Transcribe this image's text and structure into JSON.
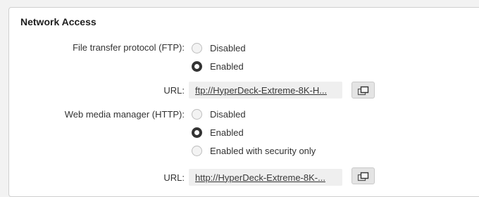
{
  "section": {
    "title": "Network Access"
  },
  "ftp": {
    "label": "File transfer protocol (FTP):",
    "options": [
      {
        "label": "Disabled",
        "selected": false
      },
      {
        "label": "Enabled",
        "selected": true
      }
    ],
    "url_label": "URL:",
    "url_value": "ftp://HyperDeck-Extreme-8K-H..."
  },
  "http": {
    "label": "Web media manager (HTTP):",
    "options": [
      {
        "label": "Disabled",
        "selected": false
      },
      {
        "label": "Enabled",
        "selected": true
      },
      {
        "label": "Enabled with security only",
        "selected": false
      }
    ],
    "url_label": "URL:",
    "url_value": "http://HyperDeck-Extreme-8K-..."
  },
  "icons": {
    "copy": "copy-to-clipboard-icon"
  },
  "colors": {
    "panel_bg": "#ffffff",
    "page_bg": "#f2f2f2",
    "radio_selected": "#333333",
    "url_field_bg": "#efefef"
  }
}
